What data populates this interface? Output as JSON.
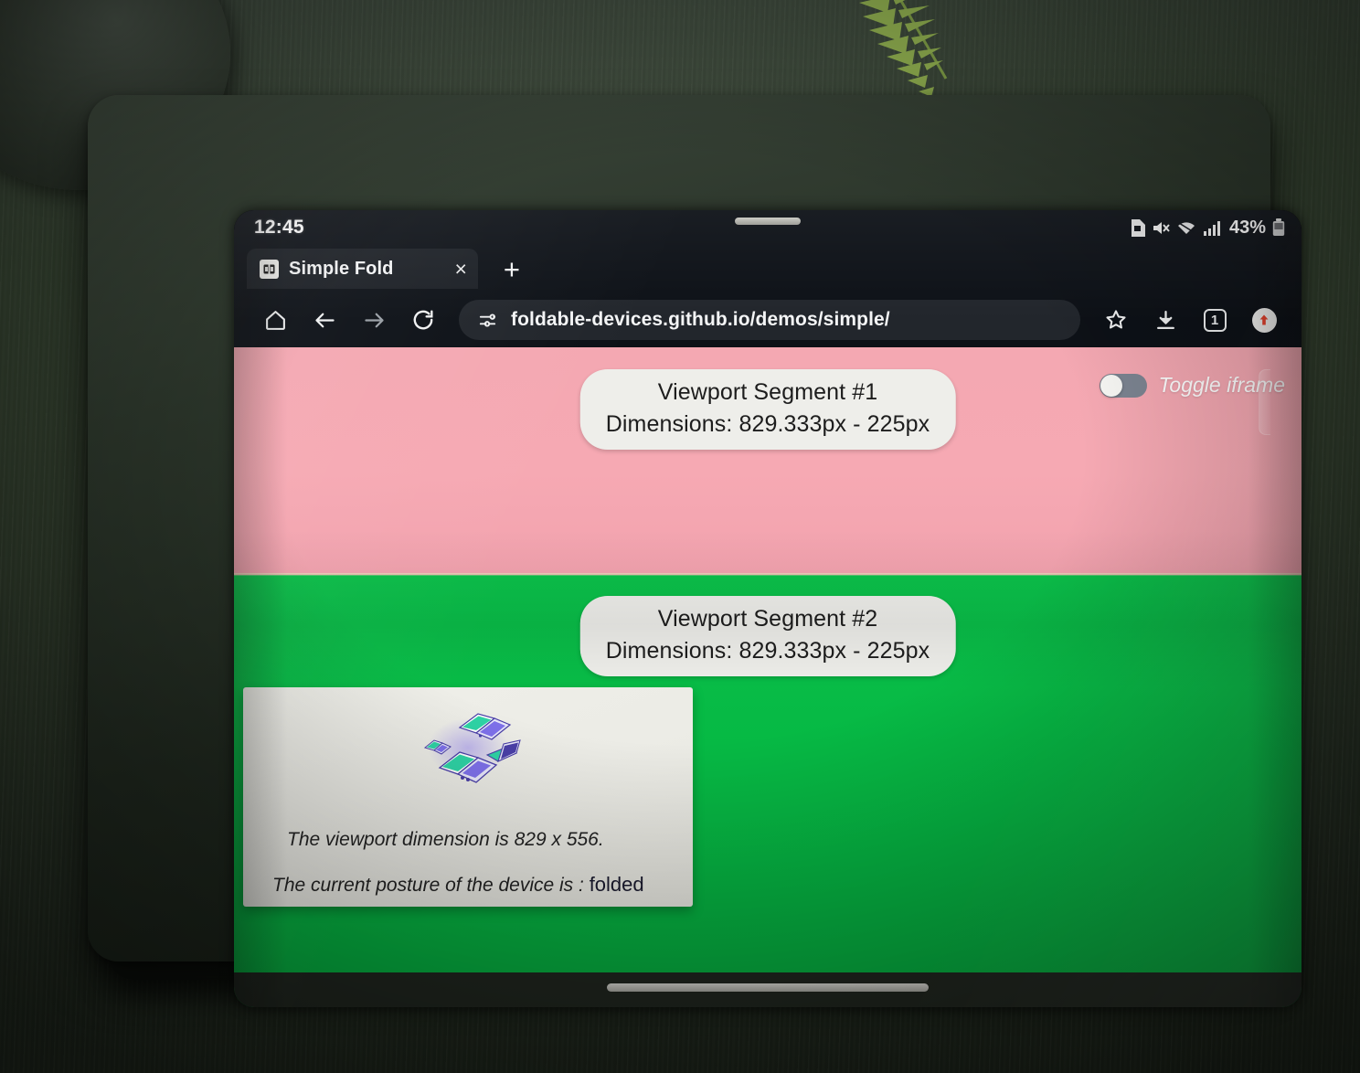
{
  "status_bar": {
    "time": "12:45",
    "battery_percent": "43%",
    "icons": [
      "sim-card-icon",
      "mute-icon",
      "wifi-icon",
      "cellular-signal-icon",
      "battery-icon"
    ]
  },
  "browser": {
    "tab": {
      "title": "Simple Fold",
      "favicon_name": "fold-favicon",
      "close_label": "×"
    },
    "new_tab_label": "+",
    "toolbar": {
      "home_icon": "home-icon",
      "back_icon": "back-arrow-icon",
      "forward_icon": "forward-arrow-icon",
      "reload_icon": "reload-icon",
      "site_settings_icon": "site-settings-icon",
      "url": "foldable-devices.github.io/demos/simple/",
      "bookmark_icon": "star-icon",
      "download_icon": "download-icon",
      "tab_count": "1",
      "profile_icon": "profile-update-icon"
    }
  },
  "page": {
    "segment1": {
      "title": "Viewport Segment #1",
      "dimensions": "Dimensions: 829.333px - 225px",
      "background_color": "#f5a8b2"
    },
    "segment2": {
      "title": "Viewport Segment #2",
      "dimensions": "Dimensions: 829.333px - 225px",
      "background_color": "#07b944"
    },
    "iframe_toggle": {
      "label": "Toggle iframe",
      "state": "off"
    },
    "info_card": {
      "illustration_name": "foldable-laptops-illustration",
      "line1": "The viewport dimension is 829 x 556.",
      "line2_prefix": "The current posture of the device is : ",
      "posture": "folded"
    }
  },
  "system_nav": {
    "gesture_pill": "home-gesture-pill"
  }
}
